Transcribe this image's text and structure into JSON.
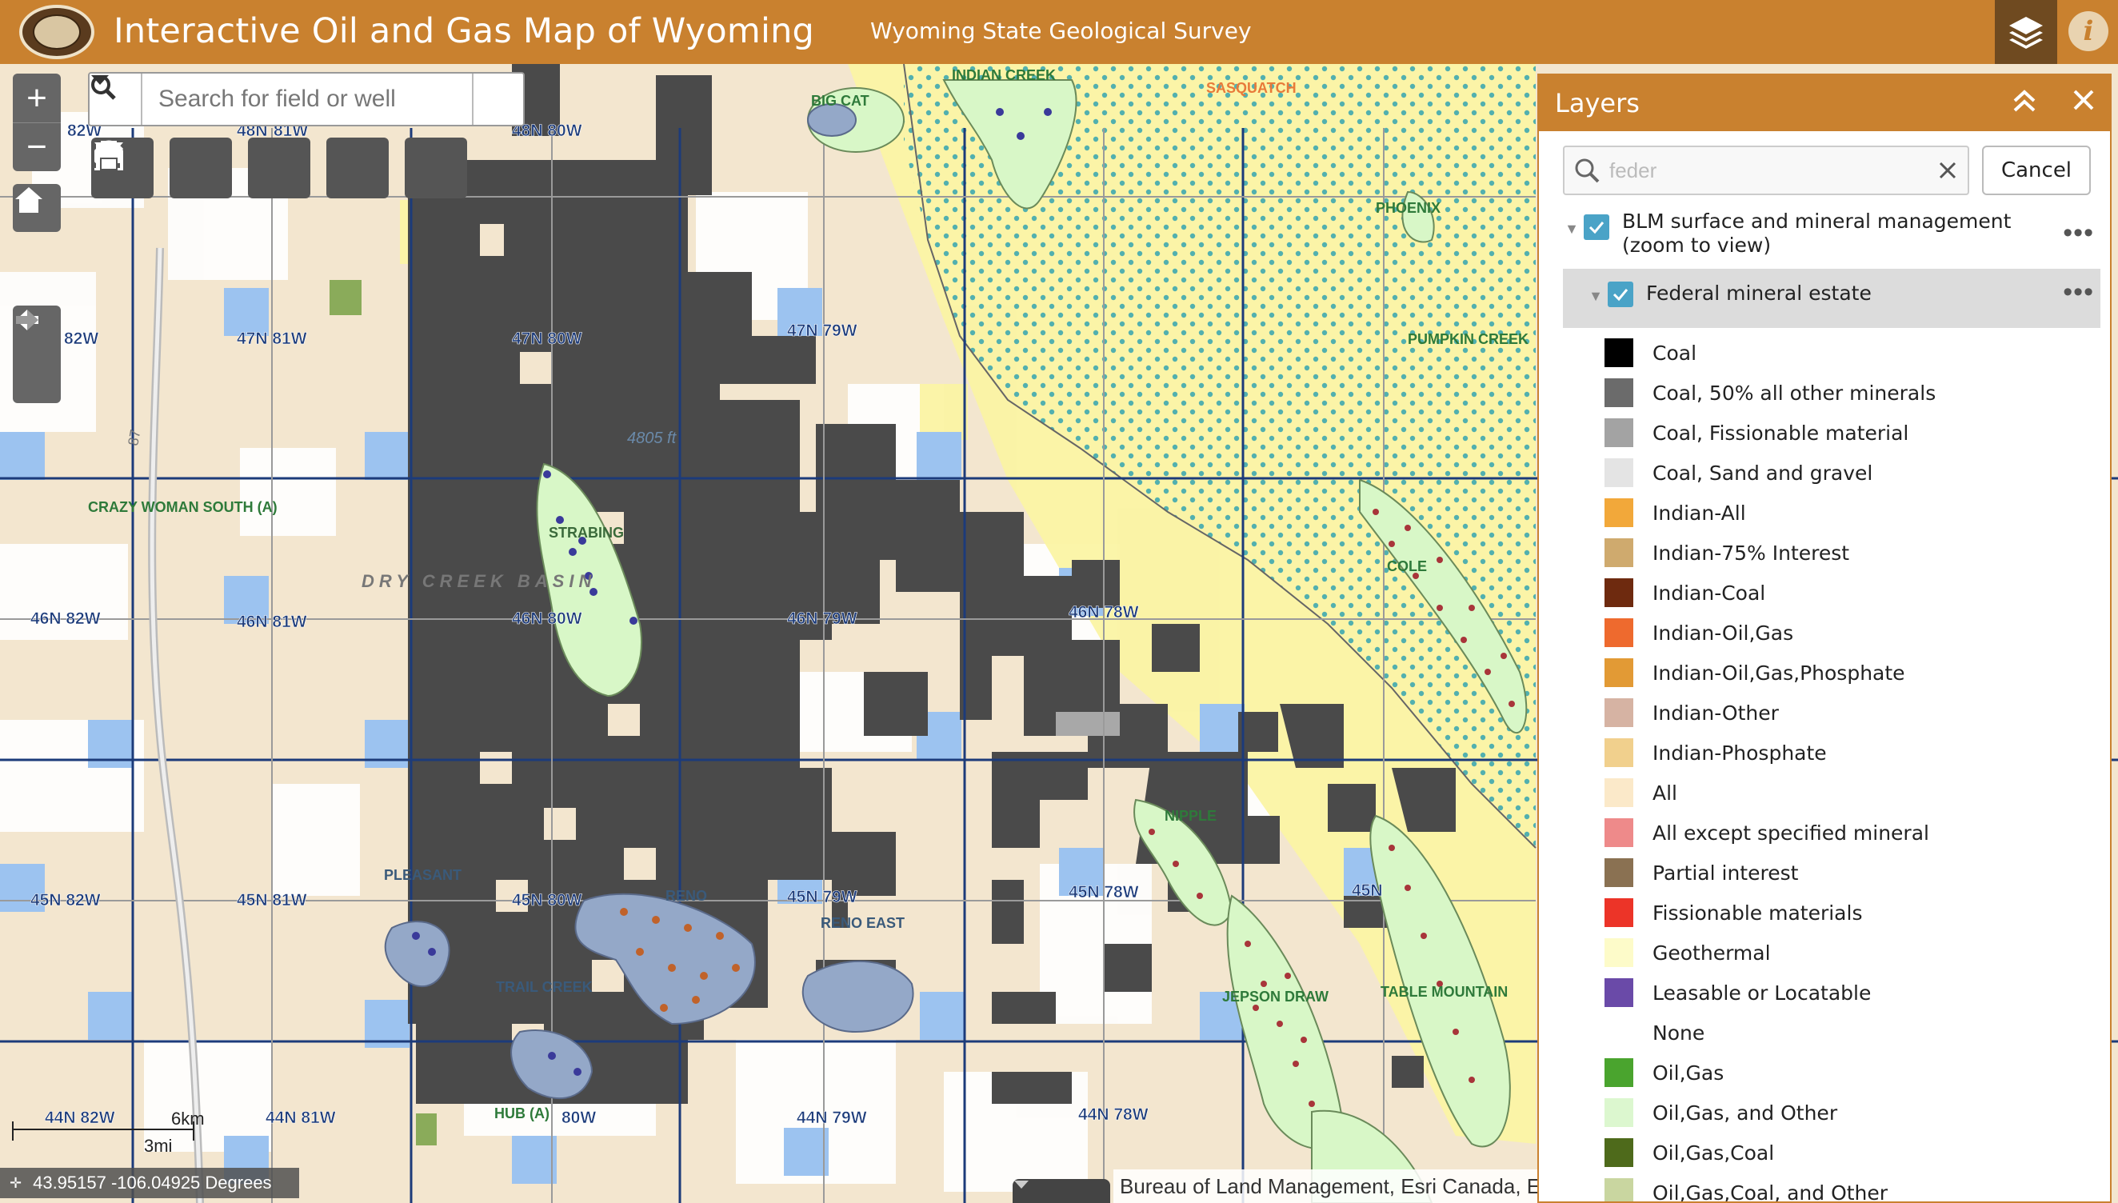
{
  "header": {
    "app_title": "Interactive Oil and Gas Map of Wyoming",
    "org_title": "Wyoming State Geological Survey",
    "layers_icon": "layers-icon",
    "info_icon": "info-icon"
  },
  "search": {
    "placeholder": "Search for field or well"
  },
  "tools": [
    "filter-icon",
    "chart-icon",
    "measure-icon",
    "basemap-icon",
    "print-icon"
  ],
  "scale": {
    "km": "6km",
    "mi": "3mi"
  },
  "coordinates": "43.95157 -106.04925 Degrees",
  "attribution": "Bureau of Land Management, Esri Canada, E",
  "map_labels": {
    "township_labels": [
      "82W",
      "48N",
      "81W",
      "48N 80W",
      "47N 81W",
      "47N 80W",
      "47N 79W",
      "82W",
      "46N 82W",
      "46N 81W",
      "46N 80W",
      "46N 79W",
      "46N 78W",
      "45N 82W",
      "45N 81W",
      "45N 80W",
      "45N 79W",
      "45N 78W",
      "45N",
      "44N 82W",
      "44N 81W",
      "80W",
      "44N 79W",
      "44N 78W"
    ],
    "field_labels": [
      "CRAZY WOMAN SOUTH (A)",
      "STRABING",
      "DRY CREEK BASIN",
      "RENO",
      "RENO EAST",
      "PLEASANT",
      "TRAIL CREEK",
      "BIG CAT",
      "INDIAN CREEK",
      "SASQUATCH",
      "PHOENIX",
      "PUMPKIN CREEK",
      "NIPPLE",
      "JEPSON DRAW",
      "TABLE MOUNTAIN",
      "COLE",
      "HUB (A)"
    ],
    "elevation": "4805 ft",
    "highway": "87"
  },
  "layers_panel": {
    "title": "Layers",
    "filter_value": "feder",
    "cancel_label": "Cancel",
    "parent_layer": "BLM surface and mineral management (zoom to view)",
    "sub_layer": "Federal mineral estate",
    "legend": [
      {
        "name": "Coal",
        "color": "#000000"
      },
      {
        "name": "Coal, 50% all other minerals",
        "color": "#6b6b6b"
      },
      {
        "name": "Coal, Fissionable material",
        "color": "#a3a3a3"
      },
      {
        "name": "Coal, Sand and gravel",
        "color": "#e4e4e4"
      },
      {
        "name": "Indian-All",
        "color": "#f2a83a"
      },
      {
        "name": "Indian-75% Interest",
        "color": "#cfaa6e"
      },
      {
        "name": "Indian-Coal",
        "color": "#6e2a0f"
      },
      {
        "name": "Indian-Oil,Gas",
        "color": "#ee6a2e"
      },
      {
        "name": "Indian-Oil,Gas,Phosphate",
        "color": "#e29a35"
      },
      {
        "name": "Indian-Other",
        "color": "#d6b3a3"
      },
      {
        "name": "Indian-Phosphate",
        "color": "#f1d08d"
      },
      {
        "name": "All",
        "color": "#fbe9c9"
      },
      {
        "name": "All except specified mineral",
        "color": "#ee8a8a"
      },
      {
        "name": "Partial interest",
        "color": "#8a7152"
      },
      {
        "name": "Fissionable materials",
        "color": "#ec3428"
      },
      {
        "name": "Geothermal",
        "color": "#fdfbc9"
      },
      {
        "name": "Leasable or Locatable",
        "color": "#6a4aa8"
      },
      {
        "name": "None",
        "color": "#ffffff"
      },
      {
        "name": "Oil,Gas",
        "color": "#4aa42e"
      },
      {
        "name": "Oil,Gas, and Other",
        "color": "#dcf7cf"
      },
      {
        "name": "Oil,Gas,Coal",
        "color": "#4e6a1b"
      },
      {
        "name": "Oil,Gas,Coal, and Other",
        "color": "#c9d6a0"
      }
    ]
  }
}
